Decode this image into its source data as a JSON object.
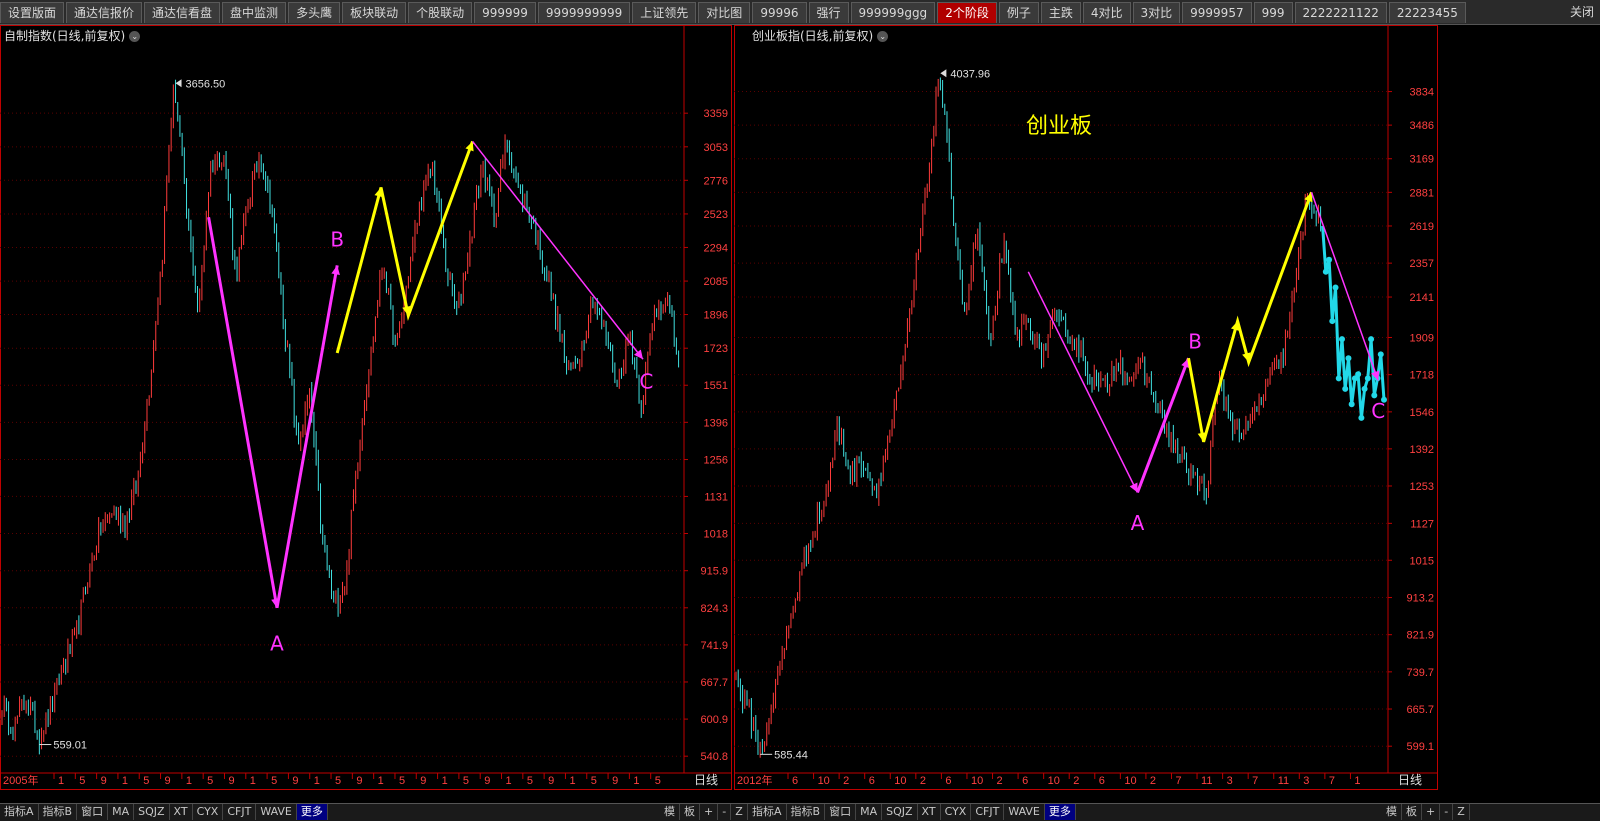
{
  "tabs": [
    {
      "label": "设置版面"
    },
    {
      "label": "通达信报价"
    },
    {
      "label": "通达信看盘"
    },
    {
      "label": "盘中监测"
    },
    {
      "label": "多头鹰"
    },
    {
      "label": "板块联动"
    },
    {
      "label": "个股联动"
    },
    {
      "label": "999999"
    },
    {
      "label": "9999999999"
    },
    {
      "label": "上证领先"
    },
    {
      "label": "对比图"
    },
    {
      "label": "99996"
    },
    {
      "label": "强行"
    },
    {
      "label": "999999ggg"
    },
    {
      "label": "2个阶段",
      "active": true
    },
    {
      "label": "例子"
    },
    {
      "label": "主跌"
    },
    {
      "label": "4对比"
    },
    {
      "label": "3对比"
    },
    {
      "label": "9999957"
    },
    {
      "label": "999"
    },
    {
      "label": "2222221122"
    },
    {
      "label": "22223455"
    }
  ],
  "close_label": "关闭",
  "bottom": {
    "left_items": [
      "指标A",
      "指标B",
      "窗口",
      "MA",
      "SQJZ",
      "XT",
      "CYX",
      "CFJT",
      "WAVE",
      "更多"
    ],
    "right_items": [
      "模",
      "板",
      "+",
      "-",
      "Z"
    ]
  },
  "colors": {
    "up": "#ff3b3b",
    "down": "#40e0e0",
    "axis": "#c00000",
    "yellow": "#ffff00",
    "magenta": "#ff33ff",
    "cyan": "#22d8e8"
  },
  "chart_data": [
    {
      "type": "candlestick",
      "title": "自制指数(日线,前复权)",
      "period_label": "日线",
      "y_scale": "log",
      "ylim": [
        520,
        4100
      ],
      "y_ticks": [
        "3359",
        "3053",
        "2776",
        "2523",
        "2294",
        "2085",
        "1896",
        "1723",
        "1551",
        "1396",
        "1256",
        "1131",
        "1018",
        "915.9",
        "824.3",
        "741.9",
        "667.7",
        "600.9",
        "540.8"
      ],
      "x_start_label": "2005年",
      "x_ticks": [
        "1",
        "5",
        "9",
        "1",
        "5",
        "9",
        "1",
        "5",
        "9",
        "1",
        "5",
        "9",
        "1",
        "5",
        "9",
        "1",
        "5",
        "9",
        "1",
        "5",
        "9",
        "1",
        "5",
        "9",
        "1",
        "5",
        "9",
        "1",
        "5"
      ],
      "high_label": "3656.50",
      "low_label": "559.01",
      "price_path": [
        620,
        590,
        640,
        570,
        620,
        700,
        760,
        900,
        1030,
        1090,
        1050,
        1180,
        1550,
        2200,
        3656,
        2500,
        1900,
        2900,
        3000,
        2100,
        2600,
        3000,
        2500,
        1800,
        1300,
        1500,
        1000,
        824,
        900,
        1300,
        1700,
        2200,
        1700,
        2100,
        2600,
        2900,
        2200,
        1900,
        2300,
        2900,
        2500,
        3100,
        2700,
        2500,
        2200,
        1900,
        1600,
        1700,
        2000,
        1800,
        1550,
        1800,
        1450,
        1900,
        2000,
        1650
      ],
      "waves": [
        {
          "color": "magenta",
          "points": [
            [
              0.305,
              2500
            ],
            [
              0.405,
              824
            ]
          ]
        },
        {
          "color": "magenta",
          "points": [
            [
              0.405,
              824
            ],
            [
              0.493,
              2180
            ]
          ]
        },
        {
          "color": "yellow",
          "points": [
            [
              0.493,
              1700
            ],
            [
              0.557,
              2720
            ],
            [
              0.597,
              1890
            ],
            [
              0.691,
              3100
            ]
          ]
        },
        {
          "color": "magenta",
          "thin": true,
          "points": [
            [
              0.691,
              3100
            ],
            [
              0.94,
              1670
            ]
          ]
        }
      ],
      "wave_labels": [
        {
          "text": "A",
          "x": 0.405,
          "y": 760
        },
        {
          "text": "B",
          "x": 0.493,
          "y": 2300
        },
        {
          "text": "C",
          "x": 0.945,
          "y": 1600
        }
      ]
    },
    {
      "type": "candlestick",
      "title": "创业板指(日线,前复权)",
      "period_label": "日线",
      "annotation": "创业板",
      "y_scale": "log",
      "ylim": [
        560,
        4400
      ],
      "y_ticks": [
        "3834",
        "3486",
        "3169",
        "2881",
        "2619",
        "2357",
        "2141",
        "1909",
        "1718",
        "1546",
        "1392",
        "1253",
        "1127",
        "1015",
        "913.2",
        "821.9",
        "739.7",
        "665.7",
        "599.1"
      ],
      "x_start_label": "2012年",
      "x_ticks": [
        "6",
        "10",
        "2",
        "6",
        "10",
        "2",
        "6",
        "10",
        "2",
        "6",
        "10",
        "2",
        "6",
        "10",
        "2",
        "7",
        "11",
        "3",
        "7",
        "11",
        "3",
        "7",
        "1"
      ],
      "high_label": "4037.96",
      "low_label": "585.44",
      "price_path": [
        720,
        660,
        585,
        700,
        820,
        960,
        1100,
        1200,
        1480,
        1300,
        1350,
        1230,
        1430,
        1700,
        2200,
        2900,
        4037,
        2800,
        2000,
        2600,
        1800,
        2500,
        1900,
        2000,
        1800,
        2000,
        1950,
        1850,
        1700,
        1650,
        1800,
        1700,
        1750,
        1600,
        1450,
        1350,
        1280,
        1220,
        1700,
        1500,
        1450,
        1550,
        1700,
        1800,
        2200,
        2881,
        2600
      ],
      "price_path_end": 0.9,
      "forecast": {
        "color": "cyan",
        "values": [
          2619,
          2300,
          2380,
          2000,
          2200,
          1700,
          1900,
          1650,
          1800,
          1580,
          1700,
          1720,
          1520,
          1650,
          1700,
          1900,
          1620,
          1700,
          1820,
          1600
        ]
      },
      "waves": [
        {
          "color": "magenta",
          "thin": true,
          "points": [
            [
              0.45,
              2300
            ],
            [
              0.617,
              1230
            ]
          ]
        },
        {
          "color": "magenta",
          "points": [
            [
              0.617,
              1230
            ],
            [
              0.695,
              1800
            ]
          ]
        },
        {
          "color": "yellow",
          "points": [
            [
              0.695,
              1800
            ],
            [
              0.718,
              1420
            ],
            [
              0.77,
              2000
            ],
            [
              0.787,
              1780
            ],
            [
              0.883,
              2881
            ]
          ]
        },
        {
          "color": "magenta",
          "thin": true,
          "points": [
            [
              0.883,
              2881
            ],
            [
              0.985,
              1690
            ]
          ]
        }
      ],
      "wave_labels": [
        {
          "text": "A",
          "x": 0.617,
          "y": 1150
        },
        {
          "text": "B",
          "x": 0.705,
          "y": 1850
        },
        {
          "text": "C",
          "x": 0.985,
          "y": 1580
        }
      ]
    }
  ]
}
